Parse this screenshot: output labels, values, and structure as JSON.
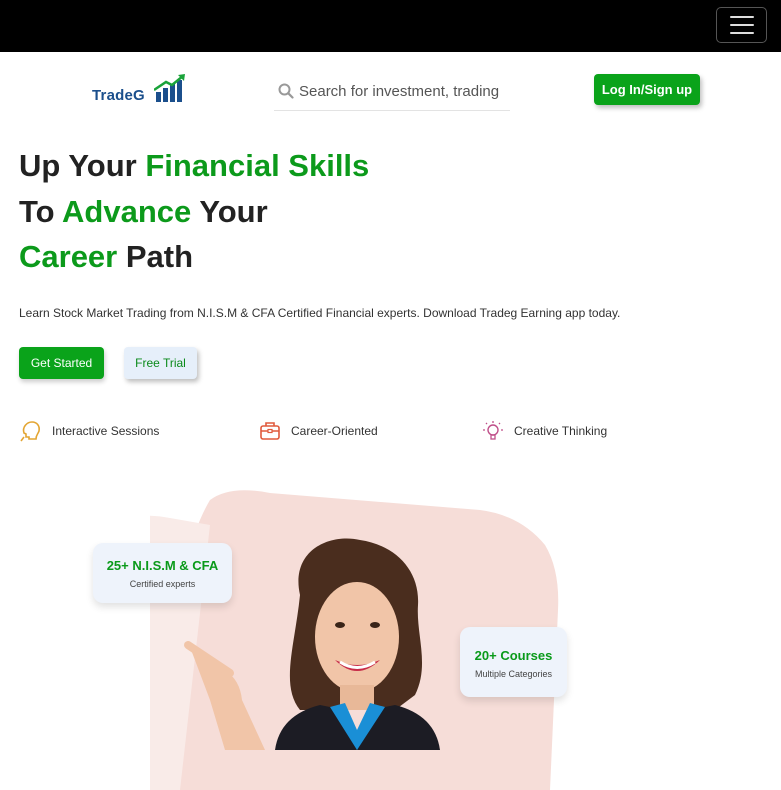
{
  "topbar": {
    "menu_icon": "hamburger-icon"
  },
  "header": {
    "logo_text": "TradeG",
    "logo_icon": "bar-chart-arrow-icon",
    "search": {
      "placeholder": "Search for investment, trading",
      "value": "",
      "icon": "search-icon"
    },
    "login_label": "Log In/Sign up"
  },
  "hero": {
    "line1": {
      "a": "Up Your ",
      "b": "Financial Skills"
    },
    "line2": {
      "a": "To ",
      "b": "Advance",
      "c": " Your"
    },
    "line3": {
      "b": "Career",
      "c": " Path"
    },
    "subtext": "Learn Stock Market Trading from N.I.S.M & CFA Certified Financial experts. Download Tradeg Earning app today.",
    "cta_start": "Get Started",
    "cta_trial": "Free Trial"
  },
  "features": [
    {
      "label": "Interactive Sessions",
      "icon": "head-icon"
    },
    {
      "label": "Career-Oriented",
      "icon": "briefcase-icon"
    },
    {
      "label": "Creative Thinking",
      "icon": "lightbulb-icon"
    }
  ],
  "badges": {
    "experts": {
      "title": "25+ N.I.S.M & CFA",
      "subtitle": "Certified experts"
    },
    "courses": {
      "title": "20+ Courses",
      "subtitle": "Multiple Categories"
    }
  },
  "colors": {
    "brand_green": "#0aa31a",
    "brand_blue": "#1b4f8c",
    "topbar": "#000000",
    "hero_shape": "#f6ddd8"
  }
}
